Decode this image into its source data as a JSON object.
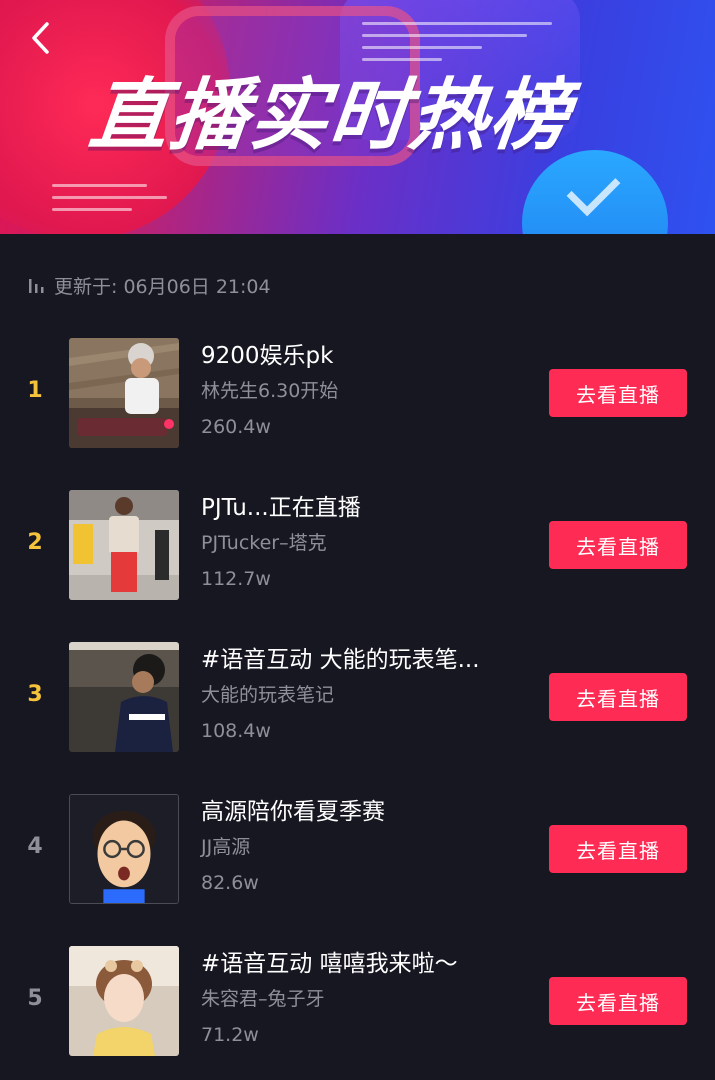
{
  "header": {
    "title": "直播实时热榜",
    "back_icon": "chevron-left-icon"
  },
  "update": {
    "label": "更新于: 06月06日 21:04",
    "icon": "bar-chart-icon"
  },
  "colors": {
    "background": "#161721",
    "accent": "#fe2c55",
    "rank_top": "#f4c33b",
    "rank_rest": "#8e8f99",
    "muted_text": "#8e8f99"
  },
  "list": [
    {
      "rank": "1",
      "title": "9200娱乐pk",
      "host": "林先生6.30开始",
      "count": "260.4w",
      "button": "去看直播"
    },
    {
      "rank": "2",
      "title": "PJTu...正在直播",
      "host": "PJTucker–塔克",
      "count": "112.7w",
      "button": "去看直播"
    },
    {
      "rank": "3",
      "title": "#语音互动 大能的玩表笔...",
      "host": "大能的玩表笔记",
      "count": "108.4w",
      "button": "去看直播"
    },
    {
      "rank": "4",
      "title": "高源陪你看夏季赛",
      "host": "JJ高源",
      "count": "82.6w",
      "button": "去看直播"
    },
    {
      "rank": "5",
      "title": "#语音互动 嘻嘻我来啦～",
      "host": "朱容君–兔子牙",
      "count": "71.2w",
      "button": "去看直播"
    }
  ]
}
